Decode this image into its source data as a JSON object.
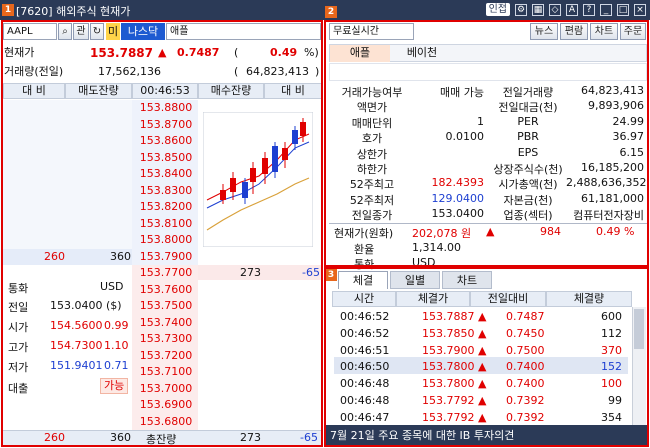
{
  "window": {
    "code": "[7620]",
    "title": "해외주식 현재가",
    "tag1": "1",
    "tag2": "2",
    "tag3": "3",
    "toolbar": {
      "dict_label": "인접"
    }
  },
  "left": {
    "symbol": "AAPL",
    "btn_pan": "관",
    "market_tag": "미",
    "exchange": "나스닥",
    "name": "애플",
    "current_label": "현재가",
    "current_price": "153.7887",
    "change_arrow": "▲",
    "change": "0.7487",
    "change_pct": "0.49",
    "pct_unit": "%)",
    "volume_label": "거래량(전일)",
    "volume": "17,562,136",
    "prev_volume": "64,823,413",
    "ob_header": {
      "c1": "대 비",
      "c2": "매도잔량",
      "time": "00:46:53",
      "c4": "매수잔량",
      "c5": "대 비"
    },
    "ask_prices": [
      "153.8800",
      "153.8700",
      "153.8600",
      "153.8500",
      "153.8400",
      "153.8300",
      "153.8200",
      "153.8100",
      "153.8000",
      "153.7900"
    ],
    "bid_prices": [
      "153.7700",
      "153.7600",
      "153.7500",
      "153.7400",
      "153.7300",
      "153.7200",
      "153.7100",
      "153.7000",
      "153.6900",
      "153.6800"
    ],
    "ask_last_diff": "260",
    "ask_last_qty": "360",
    "bid_first_qty": "273",
    "bid_first_diff": "-65",
    "info": {
      "currency_label": "통화",
      "currency": "USD",
      "prev_label": "전일",
      "prev": "153.0400",
      "prev_unit": "($)",
      "open_label": "시가",
      "open": "154.5600",
      "open_pct": "0.99",
      "high_label": "고가",
      "high": "154.7300",
      "high_pct": "1.10",
      "low_label": "저가",
      "low": "151.9401",
      "low_pct": "0.71",
      "loan_label": "대출",
      "loan_value": "가능"
    },
    "footer": {
      "diff": "260",
      "qty": "360",
      "total_label": "총잔량",
      "bid_qty": "273",
      "bid_diff": "-65"
    }
  },
  "right": {
    "search_placeholder": "무료실시간",
    "btns": [
      "뉴스",
      "편람",
      "차트",
      "주문"
    ],
    "tabs": [
      "애플",
      "베이천"
    ],
    "info_rows": [
      {
        "l": "거래가능여부",
        "v": "매매 가능",
        "l2": "전일거래량",
        "v2": "64,823,413"
      },
      {
        "l": "액면가",
        "v": "",
        "l2": "전일대금(천)",
        "v2": "9,893,906"
      },
      {
        "l": "매매단위",
        "v": "1",
        "l2": "PER",
        "v2": "24.99"
      },
      {
        "l": "호가",
        "v": "0.0100",
        "l2": "PBR",
        "v2": "36.97"
      },
      {
        "l": "상한가",
        "v": "",
        "l2": "EPS",
        "v2": "6.15"
      },
      {
        "l": "하한가",
        "v": "",
        "l2": "상장주식수(천)",
        "v2": "16,185,200"
      },
      {
        "l": "52주최고",
        "v": "182.4393",
        "l2": "시가총액(천)",
        "v2": "2,488,636,352"
      },
      {
        "l": "52주최저",
        "v": "129.0400",
        "l2": "자본금(천)",
        "v2": "61,181,000"
      },
      {
        "l": "전일종가",
        "v": "153.0400",
        "l2": "업종(섹터)",
        "v2": "컴퓨터전자장비"
      }
    ],
    "krw": {
      "label": "현재가(원화)",
      "value": "202,078 원",
      "arrow": "▲",
      "diff": "984",
      "pct": "0.49 %"
    },
    "fx": {
      "label": "환율",
      "value": "1,314.00"
    },
    "cur": {
      "label": "통화",
      "value": "USD"
    },
    "trade_tabs": [
      "체결",
      "일별",
      "차트"
    ],
    "trade_headers": [
      "시간",
      "체결가",
      "전일대비",
      "체결량"
    ],
    "trades": [
      {
        "t": "00:46:52",
        "p": "153.7887",
        "d": "0.7487",
        "q": "600"
      },
      {
        "t": "00:46:52",
        "p": "153.7850",
        "d": "0.7450",
        "q": "112"
      },
      {
        "t": "00:46:51",
        "p": "153.7900",
        "d": "0.7500",
        "q": "370"
      },
      {
        "t": "00:46:50",
        "p": "153.7800",
        "d": "0.7400",
        "q": "152"
      },
      {
        "t": "00:46:48",
        "p": "153.7800",
        "d": "0.7400",
        "q": "100"
      },
      {
        "t": "00:46:48",
        "p": "153.7792",
        "d": "0.7392",
        "q": "99"
      },
      {
        "t": "00:46:47",
        "p": "153.7792",
        "d": "0.7392",
        "q": "354"
      }
    ],
    "ticker": "7월 21일 주요 종목에 대한 IB 투자의견"
  }
}
